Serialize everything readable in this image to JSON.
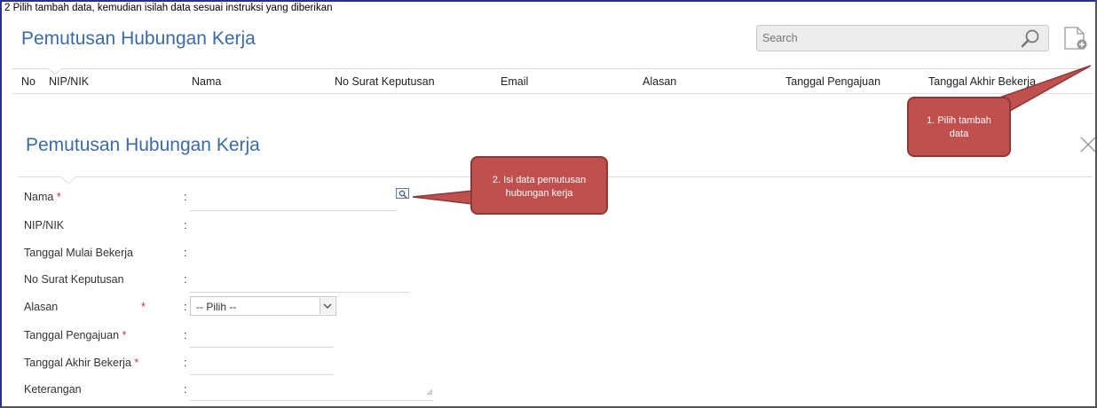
{
  "instruction": "2 Pilih tambah data, kemudian isilah data sesuai instruksi yang diberikan",
  "list_page": {
    "title": "Pemutusan Hubungan Kerja",
    "search": {
      "placeholder": "Search"
    },
    "columns": [
      "No",
      "NIP/NIK",
      "Nama",
      "No Surat Keputusan",
      "Email",
      "Alasan",
      "Tanggal Pengajuan",
      "Tanggal Akhir Bekerja"
    ]
  },
  "callouts": {
    "add": {
      "line1": "1. Pilih tambah",
      "line2": "data"
    },
    "fill": {
      "line1": "2. Isi data pemutusan",
      "line2": "hubungan kerja"
    }
  },
  "form": {
    "title": "Pemutusan Hubungan Kerja",
    "colon": ":",
    "required_mark": "*",
    "fields": {
      "nama": "Nama",
      "nip": "NIP/NIK",
      "tanggal_mulai": "Tanggal Mulai Bekerja",
      "no_surat": "No Surat Keputusan",
      "alasan": "Alasan",
      "tanggal_pengajuan": "Tanggal Pengajuan",
      "tanggal_akhir": "Tanggal Akhir Bekerja",
      "keterangan": "Keterangan"
    },
    "alasan_selected": "-- Pilih --"
  },
  "colors": {
    "title_blue": "#3a6aa8",
    "callout_red": "#c0504d",
    "required_red": "#d0312d"
  },
  "icons": {
    "search": "search-icon",
    "add": "add-document-icon",
    "lookup": "lookup-icon",
    "close": "close-icon",
    "select": "chevron-down-icon"
  }
}
